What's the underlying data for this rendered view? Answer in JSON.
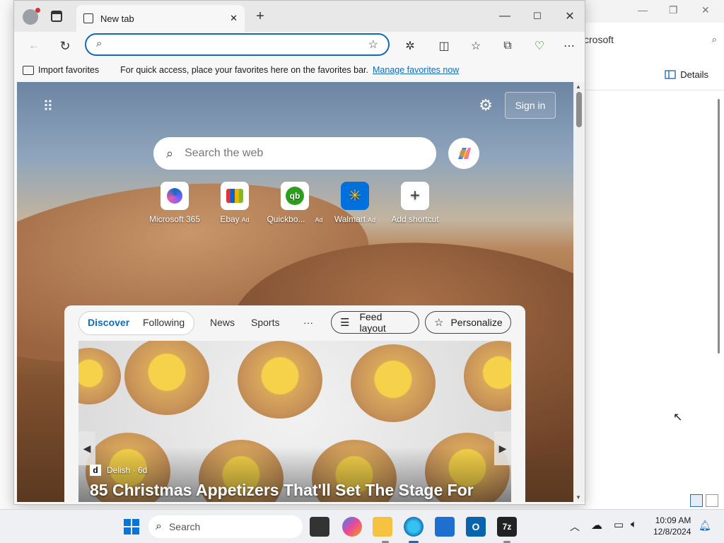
{
  "background_window": {
    "address_fragment": "crosoft",
    "details_label": "Details"
  },
  "browser": {
    "tab_title": "New tab",
    "address_value": "",
    "favorites_bar": {
      "import_label": "Import favorites",
      "message": "For quick access, place your favorites here on the favorites bar.",
      "manage_link": "Manage favorites now"
    }
  },
  "newtab": {
    "sign_in": "Sign in",
    "search_placeholder": "Search the web",
    "shortcuts": [
      {
        "label": "Microsoft 365",
        "ad": ""
      },
      {
        "label": "Ebay",
        "ad": "Ad"
      },
      {
        "label": "Quickbo...",
        "ad": "Ad"
      },
      {
        "label": "Walmart",
        "ad": "Ad"
      },
      {
        "label": "Add shortcut",
        "ad": ""
      }
    ],
    "feed": {
      "tabs": [
        "Discover",
        "Following",
        "News",
        "Sports",
        "···"
      ],
      "feed_layout": "Feed layout",
      "personalize": "Personalize",
      "hero_source": "Delish · 6d",
      "hero_source_initial": "d",
      "hero_title": "85 Christmas Appetizers That'll Set The Stage For"
    }
  },
  "taskbar": {
    "search_label": "Search",
    "time": "10:09 AM",
    "date": "12/8/2024"
  },
  "colors": {
    "accent": "#0f6cbd"
  }
}
